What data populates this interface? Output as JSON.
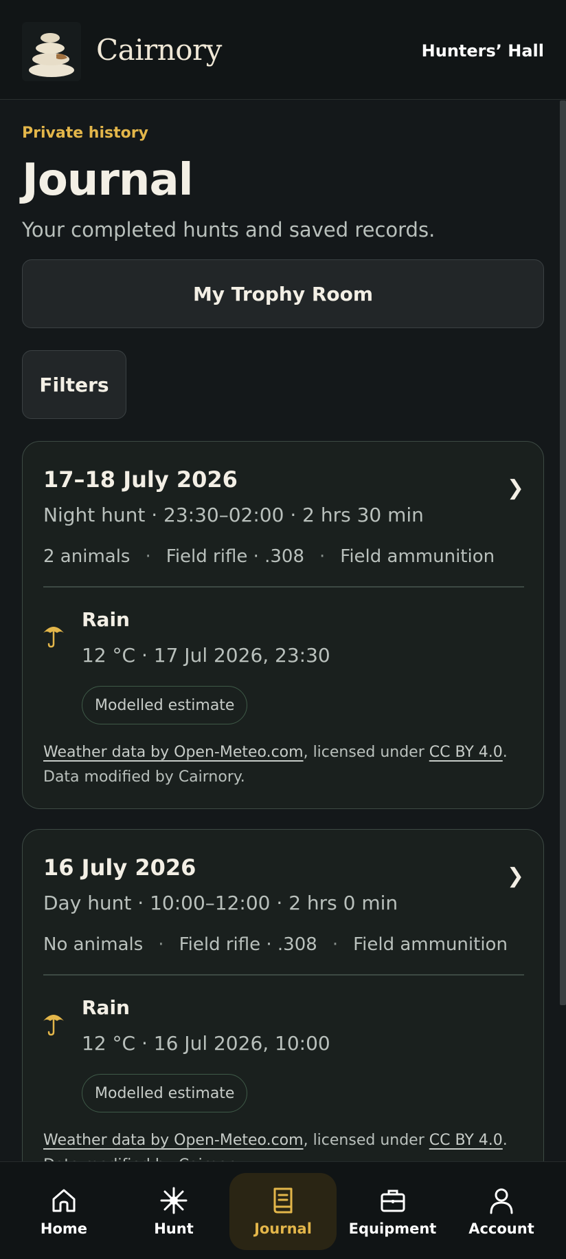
{
  "header": {
    "brand": "Cairnory",
    "hall_link": "Hunters’ Hall",
    "logo_icon": "cairn-stones-icon"
  },
  "page": {
    "eyebrow": "Private history",
    "title": "Journal",
    "subtitle": "Your completed hunts and saved records.",
    "trophy_button": "My Trophy Room",
    "filters_button": "Filters"
  },
  "entries": [
    {
      "date": "17–18 July 2026",
      "meta": "Night hunt · 23:30–02:00 · 2 hrs 30 min",
      "animals": "2 animals",
      "weapon": "Field rifle · .308",
      "ammo": "Field ammunition",
      "weather_icon": "umbrella-icon",
      "weather_title": "Rain",
      "weather_detail": "12 °C · 17 Jul 2026, 23:30",
      "badge": "Modelled estimate",
      "attr_link": "Weather data by Open-Meteo.com",
      "attr_mid": ", licensed under ",
      "attr_license": "CC BY 4.0",
      "attr_tail": ". Data modified by Cairnory."
    },
    {
      "date": "16 July 2026",
      "meta": "Day hunt · 10:00–12:00 · 2 hrs 0 min",
      "animals": "No animals",
      "weapon": "Field rifle · .308",
      "ammo": "Field ammunition",
      "weather_icon": "umbrella-icon",
      "weather_title": "Rain",
      "weather_detail": "12 °C · 16 Jul 2026, 10:00",
      "badge": "Modelled estimate",
      "attr_link": "Weather data by Open-Meteo.com",
      "attr_mid": ", licensed under ",
      "attr_license": "CC BY 4.0",
      "attr_tail": ". Data modified by Cairnory."
    }
  ],
  "nav": {
    "home": "Home",
    "hunt": "Hunt",
    "journal": "Journal",
    "equipment": "Equipment",
    "account": "Account",
    "active": "journal"
  },
  "colors": {
    "accent": "#e3b64a",
    "background": "#14181a",
    "card": "#1a201e"
  }
}
